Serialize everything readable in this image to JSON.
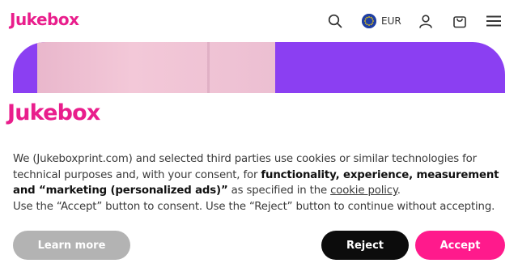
{
  "header": {
    "logo": "Jukebox",
    "currency": "EUR",
    "icons": [
      "search-icon",
      "globe-flag-icon",
      "user-icon",
      "cart-icon",
      "menu-icon"
    ]
  },
  "cookie": {
    "logo": "Jukebox",
    "text_part1": "We (Jukeboxprint.com) and selected third parties use cookies or similar technologies for technical purposes and, with your consent, for ",
    "text_bold": "functionality, experience, measurement and “marketing (personalized ads)”",
    "text_part2": " as specified in the ",
    "policy_link": "cookie policy",
    "text_part3": ".",
    "text_line2": "Use the “Accept” button to consent. Use the “Reject” button to continue without accepting.",
    "learn_more": "Learn more",
    "reject": "Reject",
    "accept": "Accept"
  },
  "colors": {
    "brand_pink": "#e91e8c",
    "hero_purple": "#8b3ff2",
    "accept_bg": "#ff1a8c",
    "reject_bg": "#0c0c0c",
    "learn_bg": "#b3b3b3"
  }
}
